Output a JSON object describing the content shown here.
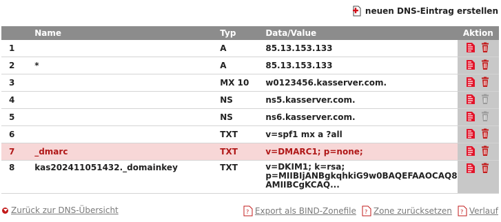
{
  "top_action": {
    "label": "neuen DNS-Eintrag erstellen",
    "icon": "add-document-icon"
  },
  "table": {
    "headers": {
      "num": "",
      "name": "Name",
      "type": "Typ",
      "data": "Data/Value",
      "action": "Aktion"
    },
    "rows": [
      {
        "num": "1",
        "name": "",
        "type": "A",
        "data": "85.13.153.133",
        "highlight": false
      },
      {
        "num": "2",
        "name": "*",
        "type": "A",
        "data": "85.13.153.133",
        "highlight": false
      },
      {
        "num": "3",
        "name": "",
        "type": "MX 10",
        "data": "w0123456.kasserver.com.",
        "highlight": false
      },
      {
        "num": "4",
        "name": "",
        "type": "NS",
        "data": "ns5.kasserver.com.",
        "highlight": false,
        "delete_disabled": true
      },
      {
        "num": "5",
        "name": "",
        "type": "NS",
        "data": "ns6.kasserver.com.",
        "highlight": false,
        "delete_disabled": true
      },
      {
        "num": "6",
        "name": "",
        "type": "TXT",
        "data": "v=spf1 mx a ?all",
        "highlight": false
      },
      {
        "num": "7",
        "name": "_dmarc",
        "type": "TXT",
        "data": "v=DMARC1; p=none;",
        "highlight": true
      },
      {
        "num": "8",
        "name": "kas202411051432._domainkey",
        "type": "TXT",
        "data_lines": [
          "v=DKIM1; k=rsa;",
          "p=MIIBIjANBgkqhkiG9w0BAQEFAAOCAQ8",
          "AMIIBCgKCAQ..."
        ],
        "highlight": false
      }
    ]
  },
  "footer": {
    "back": "Zurück zur DNS-Übersicht",
    "export": "Export als BIND-Zonefile",
    "reset": "Zone zurücksetzen",
    "history": "Verlauf"
  },
  "colors": {
    "header_bg": "#8c8c8c",
    "accent": "#c21a1a",
    "highlight_bg": "#f7d7d7",
    "action_col_bg": "#c8c8c8"
  }
}
